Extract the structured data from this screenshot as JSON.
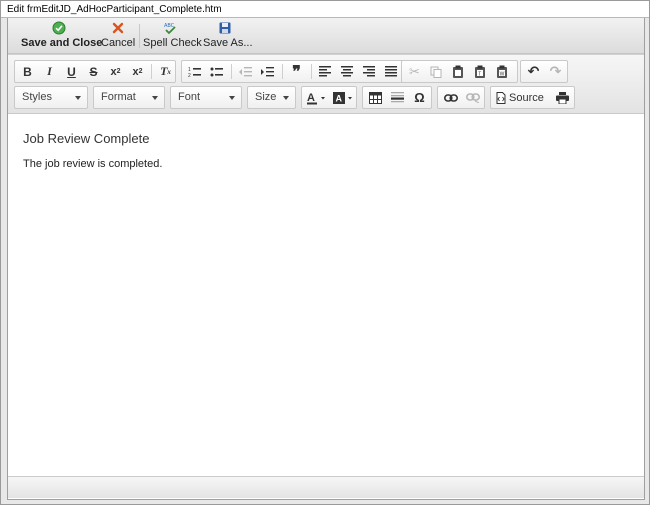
{
  "window": {
    "title": "Edit frmEditJD_AdHocParticipant_Complete.htm"
  },
  "actions": {
    "save_close": "Save and Close",
    "cancel": "Cancel",
    "spell": "Spell Check",
    "save_as": "Save As..."
  },
  "toolbar": {
    "styles": "Styles",
    "format": "Format",
    "font": "Font",
    "size": "Size",
    "source": "Source"
  },
  "document": {
    "heading": "Job Review Complete",
    "body": "The job review is completed."
  }
}
